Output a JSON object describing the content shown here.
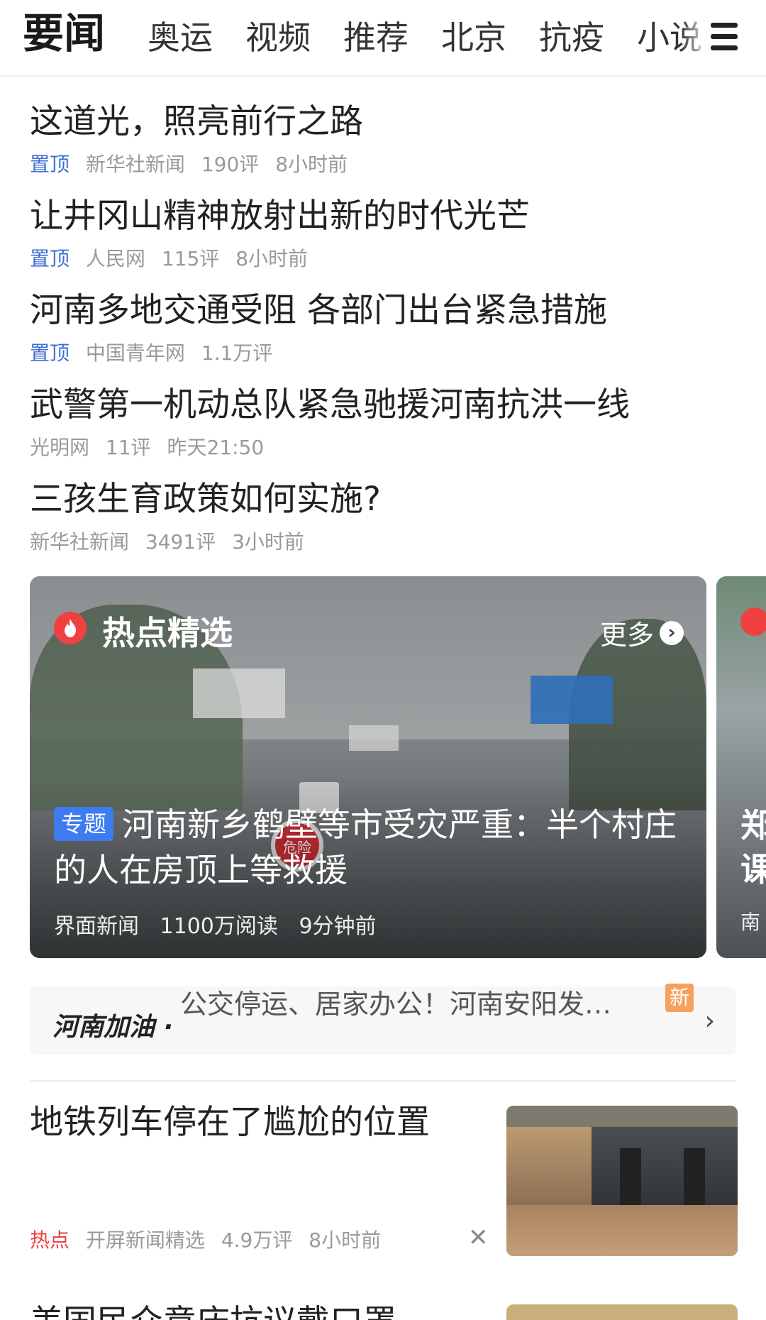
{
  "tabs": [
    {
      "label": "要闻",
      "active": true
    },
    {
      "label": "奥运"
    },
    {
      "label": "视频"
    },
    {
      "label": "推荐"
    },
    {
      "label": "北京"
    },
    {
      "label": "抗疫"
    },
    {
      "label": "小说"
    }
  ],
  "menu_icon": "hamburger-menu-icon",
  "headlines": [
    {
      "title": "这道光，照亮前行之路",
      "pinned": "置顶",
      "source": "新华社新闻",
      "comments": "190评",
      "time": "8小时前"
    },
    {
      "title": "让井冈山精神放射出新的时代光芒",
      "pinned": "置顶",
      "source": "人民网",
      "comments": "115评",
      "time": "8小时前"
    },
    {
      "title": "河南多地交通受阻 各部门出台紧急措施",
      "pinned": "置顶",
      "source": "中国青年网",
      "comments": "1.1万评"
    },
    {
      "title": "武警第一机动总队紧急驰援河南抗洪一线",
      "source": "光明网",
      "comments": "11评",
      "time": "昨天21:50"
    },
    {
      "title": "三孩生育政策如何实施?",
      "source": "新华社新闻",
      "comments": "3491评",
      "time": "3小时前"
    }
  ],
  "hot_section": {
    "label": "热点精选",
    "more_label": "更多",
    "topic_badge": "专题",
    "title": "河南新乡鹤壁等市受灾严重：半个村庄的人在房顶上等救援",
    "source": "界面新闻",
    "reads": "1100万阅读",
    "time": "9分钟前",
    "sign_text": "危险",
    "next_card": {
      "title": "郑课",
      "source": "南"
    }
  },
  "ticker": {
    "brand": "河南加油",
    "text": "公交停运、居家办公！河南安阳发…",
    "badge": "新"
  },
  "news_item": {
    "title": "地铁列车停在了尴尬的位置",
    "tag": "热点",
    "source": "开屏新闻精选",
    "comments": "4.9万评",
    "time": "8小时前"
  },
  "next_item": {
    "title": "美国民众意庆抗议戴口罩"
  },
  "colors": {
    "accent_blue": "#3f6fd6",
    "hot_red": "#f04142",
    "meta_gray": "#999999",
    "badge_orange": "#f7a05f"
  }
}
